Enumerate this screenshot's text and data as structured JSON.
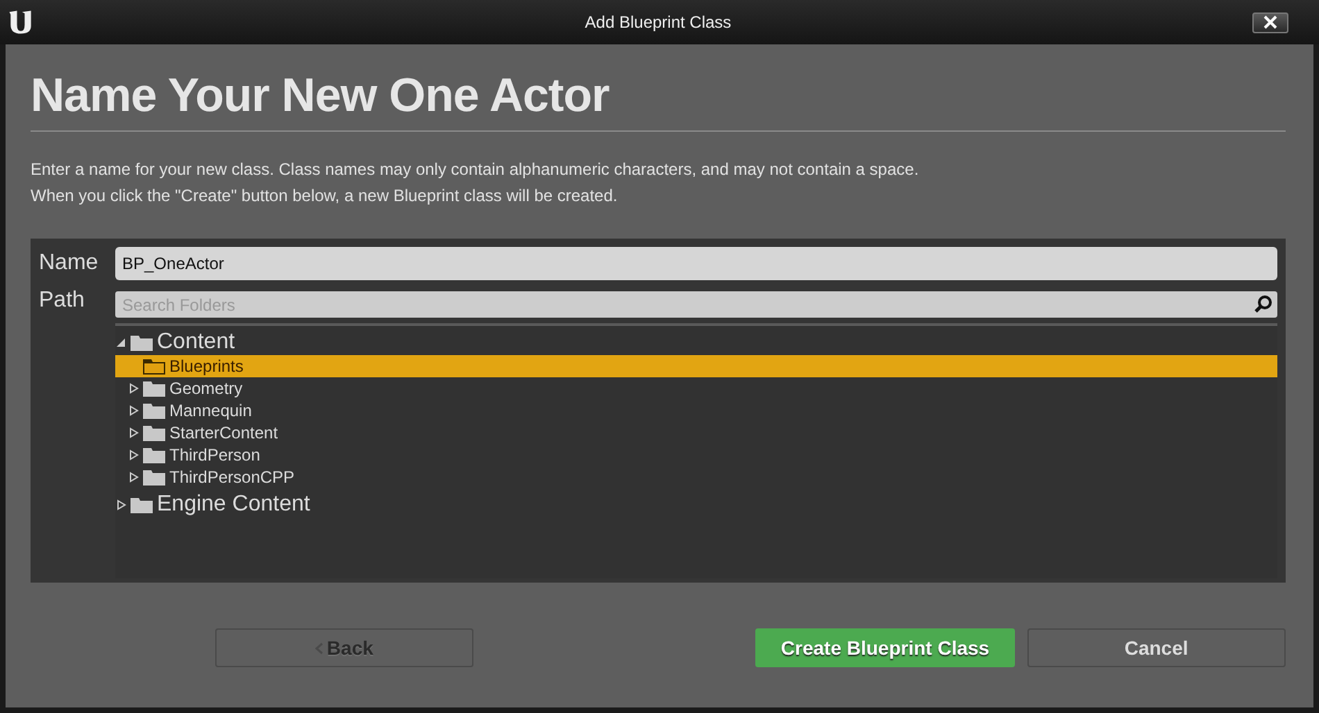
{
  "window": {
    "title": "Add Blueprint Class"
  },
  "heading": "Name Your New One Actor",
  "description": [
    "Enter a name for your new class. Class names may only contain alphanumeric characters, and may not contain a space.",
    "When you click the \"Create\" button below, a new Blueprint class will be created."
  ],
  "name_field": {
    "label": "Name",
    "value": "BP_OneActor"
  },
  "path": {
    "label": "Path",
    "search": {
      "placeholder": "Search Folders"
    },
    "tree": [
      {
        "label": "Content",
        "expandable": true,
        "expanded": true,
        "selected": false,
        "children": [
          {
            "label": "Blueprints",
            "expandable": false,
            "selected": true
          },
          {
            "label": "Geometry",
            "expandable": true,
            "expanded": false,
            "selected": false
          },
          {
            "label": "Mannequin",
            "expandable": true,
            "expanded": false,
            "selected": false
          },
          {
            "label": "StarterContent",
            "expandable": true,
            "expanded": false,
            "selected": false
          },
          {
            "label": "ThirdPerson",
            "expandable": true,
            "expanded": false,
            "selected": false
          },
          {
            "label": "ThirdPersonCPP",
            "expandable": true,
            "expanded": false,
            "selected": false
          }
        ]
      },
      {
        "label": "Engine Content",
        "expandable": true,
        "expanded": false,
        "selected": false
      }
    ]
  },
  "buttons": [
    {
      "kind": "back",
      "label": "Back",
      "disabled": true
    },
    {
      "kind": "primary",
      "label": "Create Blueprint Class",
      "disabled": false
    },
    {
      "kind": "plain",
      "label": "Cancel",
      "disabled": false
    }
  ]
}
